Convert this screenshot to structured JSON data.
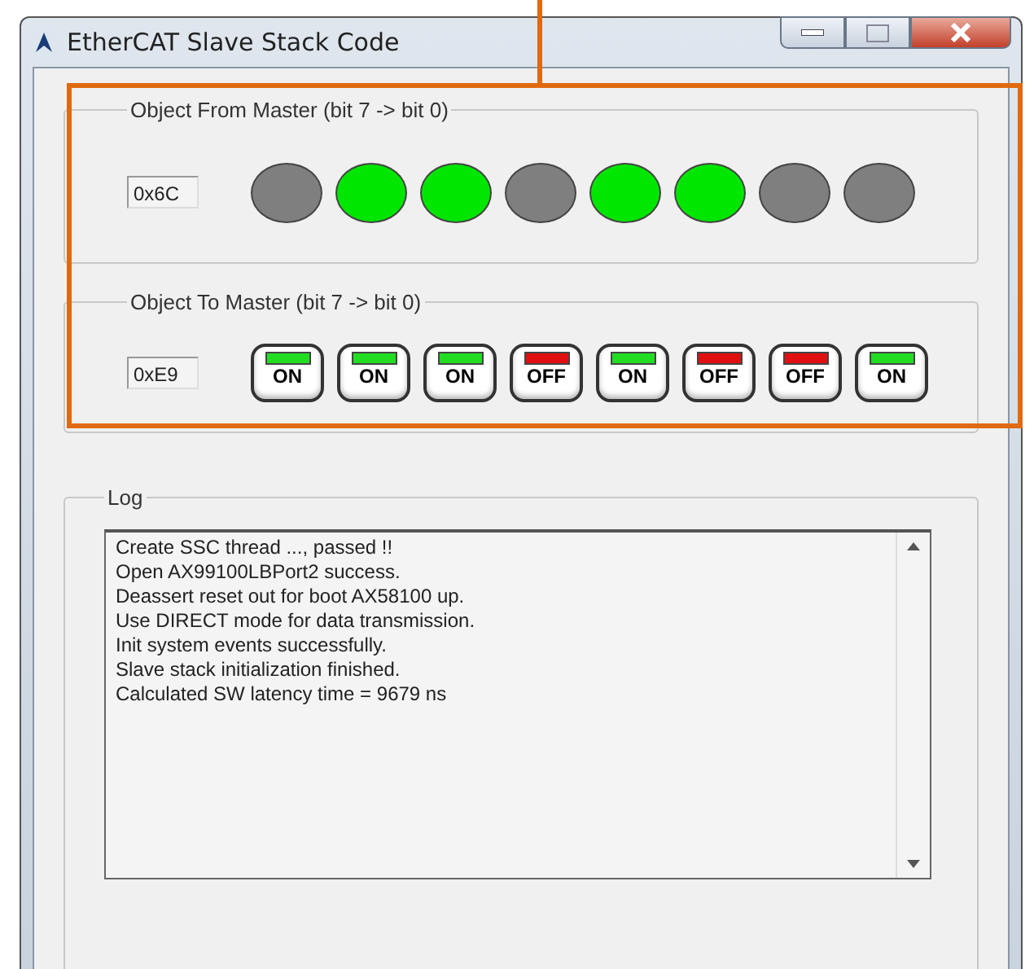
{
  "window": {
    "title": "EtherCAT Slave Stack Code"
  },
  "from_master": {
    "legend": "Object From Master (bit 7 -> bit 0)",
    "value": "0x6C",
    "leds": [
      {
        "on": false
      },
      {
        "on": true
      },
      {
        "on": true
      },
      {
        "on": false
      },
      {
        "on": true
      },
      {
        "on": true
      },
      {
        "on": false
      },
      {
        "on": false
      }
    ]
  },
  "to_master": {
    "legend": "Object To Master (bit 7 -> bit 0)",
    "value": "0xE9",
    "switches": [
      {
        "label": "ON",
        "on": true
      },
      {
        "label": "ON",
        "on": true
      },
      {
        "label": "ON",
        "on": true
      },
      {
        "label": "OFF",
        "on": false
      },
      {
        "label": "ON",
        "on": true
      },
      {
        "label": "OFF",
        "on": false
      },
      {
        "label": "OFF",
        "on": false
      },
      {
        "label": "ON",
        "on": true
      }
    ]
  },
  "log": {
    "legend": "Log",
    "lines": [
      "Create SSC thread ..., passed !!",
      "Open AX99100LBPort2 success.",
      "Deassert reset out for boot AX58100 up.",
      "Use DIRECT mode for data transmission.",
      "Init system events successfully.",
      "Slave stack initialization finished.",
      "Calculated SW latency time = 9679 ns"
    ]
  }
}
